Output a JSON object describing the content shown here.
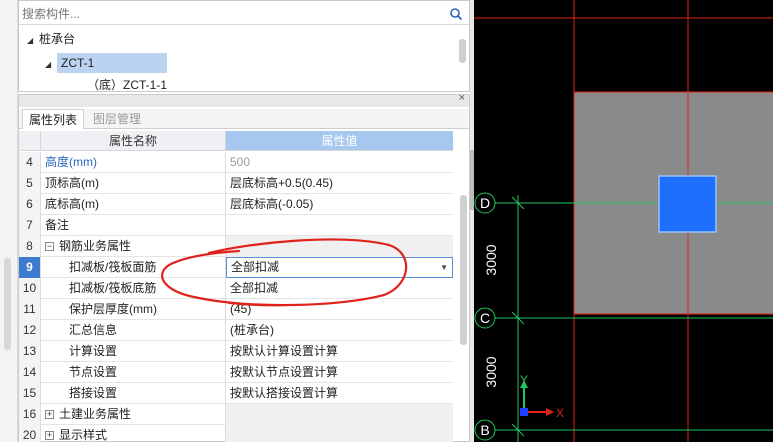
{
  "tree": {
    "search_placeholder": "搜索构件...",
    "items": [
      {
        "label": "桩承台"
      },
      {
        "label": "ZCT-1"
      },
      {
        "label": "（底）ZCT-1-1"
      }
    ]
  },
  "properties": {
    "tabs": [
      "属性列表",
      "图层管理"
    ],
    "header": {
      "name": "属性名称",
      "value": "属性值"
    },
    "rows": [
      {
        "num": "4",
        "name": "高度(mm)",
        "value": "500"
      },
      {
        "num": "5",
        "name": "顶标高(m)",
        "value": "层底标高+0.5(0.45)"
      },
      {
        "num": "6",
        "name": "底标高(m)",
        "value": "层底标高(-0.05)"
      },
      {
        "num": "7",
        "name": "备注",
        "value": ""
      },
      {
        "num": "8",
        "name": "钢筋业务属性",
        "value": "",
        "expander": "−"
      },
      {
        "num": "9",
        "name": "扣减板/筏板面筋",
        "value": "全部扣减"
      },
      {
        "num": "10",
        "name": "扣减板/筏板底筋",
        "value": "全部扣减"
      },
      {
        "num": "11",
        "name": "保护层厚度(mm)",
        "value": "(45)"
      },
      {
        "num": "12",
        "name": "汇总信息",
        "value": "(桩承台)"
      },
      {
        "num": "13",
        "name": "计算设置",
        "value": "按默认计算设置计算"
      },
      {
        "num": "14",
        "name": "节点设置",
        "value": "按默认节点设置计算"
      },
      {
        "num": "15",
        "name": "搭接设置",
        "value": "按默认搭接设置计算"
      },
      {
        "num": "16",
        "name": "土建业务属性",
        "value": "",
        "expander": "+"
      },
      {
        "num": "20",
        "name": "显示样式",
        "value": "",
        "expander": "+"
      }
    ]
  },
  "canvas": {
    "axis_labels": [
      "D",
      "C",
      "B"
    ],
    "dimensions": [
      "3000",
      "3000"
    ],
    "ucs": {
      "x": "X",
      "y": "Y"
    }
  },
  "colors": {
    "accent": "#3d7bd1",
    "header_value_bg": "#a6c8ee",
    "annotation_red": "#e0221d",
    "column_blue": "#1f6fff",
    "grid_green": "#22c55e",
    "slab_grey": "#8a8a8a"
  }
}
